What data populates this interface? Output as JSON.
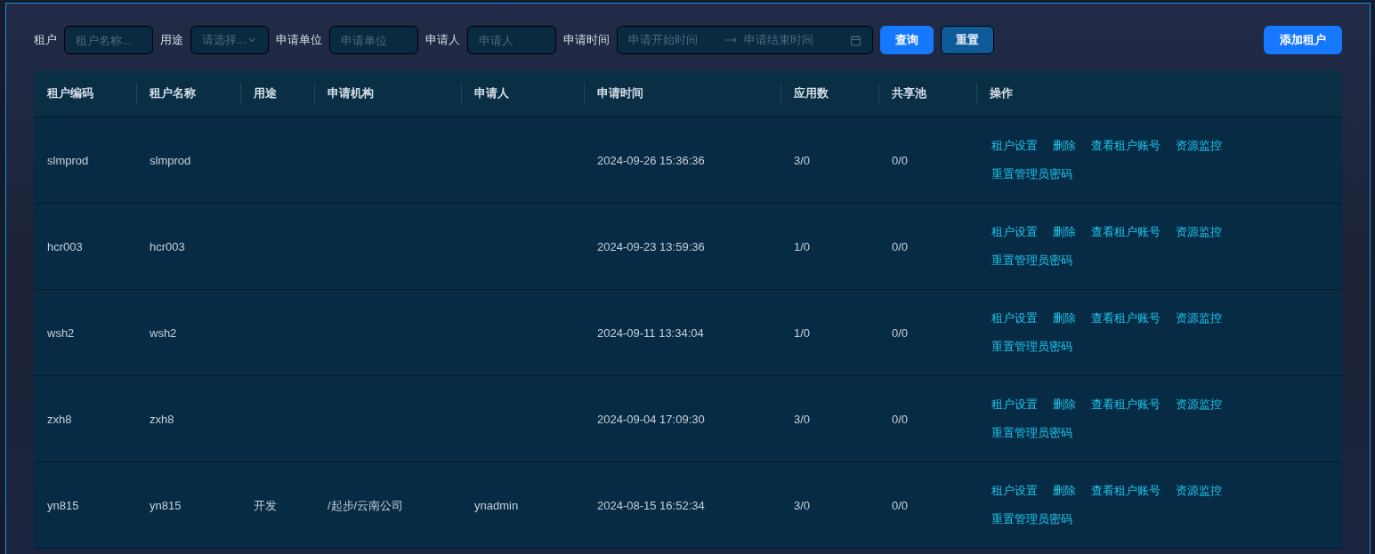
{
  "filters": [
    {
      "label": "租户",
      "kind": "input",
      "placeholder": "租户名称..."
    },
    {
      "label": "用途",
      "kind": "select",
      "placeholder": "请选择..."
    },
    {
      "label": "申请单位",
      "kind": "input",
      "placeholder": "申请单位"
    },
    {
      "label": "申请人",
      "kind": "input",
      "placeholder": "申请人"
    },
    {
      "label": "申请时间",
      "kind": "daterange",
      "placeholder": "申请开始时间",
      "placeholder_end": "申请结束时间"
    }
  ],
  "buttons": [
    {
      "label": "查询",
      "kind": "primary"
    },
    {
      "label": "重置",
      "kind": "secondary"
    }
  ],
  "add_button": "添加租户",
  "table": {
    "columns": [
      "租户编码",
      "租户名称",
      "用途",
      "申请机构",
      "申请人",
      "申请时间",
      "应用数",
      "共享池",
      "操作"
    ],
    "rows": [
      {
        "cells": [
          "slmprod",
          "slmprod",
          "",
          "",
          "",
          "2024-09-26 15:36:36",
          "3/0",
          "0/0"
        ],
        "actions": [
          "租户设置",
          "删除",
          "查看租户账号",
          "资源监控",
          "重置管理员密码"
        ]
      },
      {
        "cells": [
          "hcr003",
          "hcr003",
          "",
          "",
          "",
          "2024-09-23 13:59:36",
          "1/0",
          "0/0"
        ],
        "actions": [
          "租户设置",
          "删除",
          "查看租户账号",
          "资源监控",
          "重置管理员密码"
        ]
      },
      {
        "cells": [
          "wsh2",
          "wsh2",
          "",
          "",
          "",
          "2024-09-11 13:34:04",
          "1/0",
          "0/0"
        ],
        "actions": [
          "租户设置",
          "删除",
          "查看租户账号",
          "资源监控",
          "重置管理员密码"
        ]
      },
      {
        "cells": [
          "zxh8",
          "zxh8",
          "",
          "",
          "",
          "2024-09-04 17:09:30",
          "3/0",
          "0/0"
        ],
        "actions": [
          "租户设置",
          "删除",
          "查看租户账号",
          "资源监控",
          "重置管理员密码"
        ]
      },
      {
        "cells": [
          "yn815",
          "yn815",
          "开发",
          "/起步/云南公司",
          "ynadmin",
          "2024-08-15 16:52:34",
          "3/0",
          "0/0"
        ],
        "actions": [
          "租户设置",
          "删除",
          "查看租户账号",
          "资源监控",
          "重置管理员密码"
        ]
      }
    ]
  }
}
